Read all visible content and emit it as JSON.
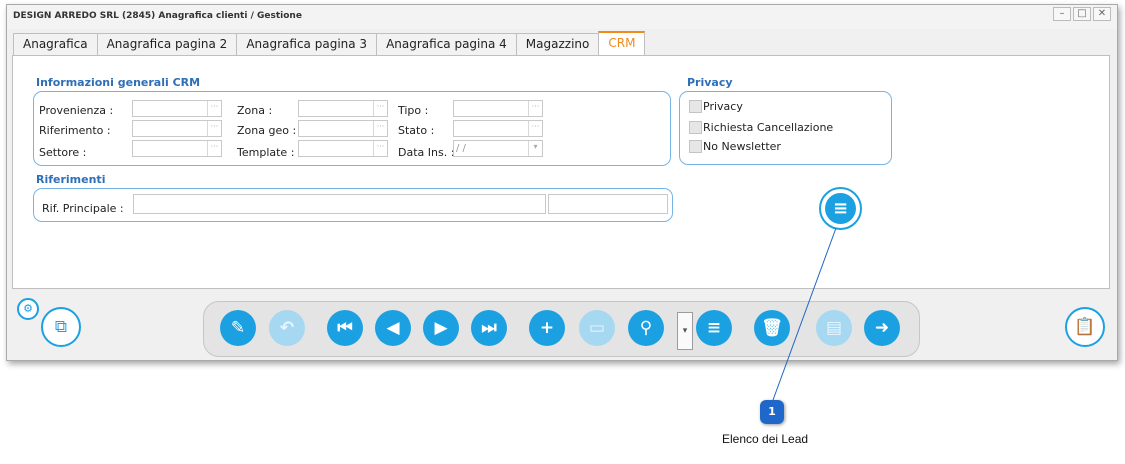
{
  "window": {
    "title": "DESIGN ARREDO SRL (2845) Anagrafica clienti / Gestione",
    "controls": {
      "minimize": "–",
      "maximize": "□",
      "close": "✕"
    }
  },
  "tabs": [
    "Anagrafica",
    "Anagrafica pagina 2",
    "Anagrafica pagina 3",
    "Anagrafica pagina 4",
    "Magazzino",
    "CRM"
  ],
  "active_tab": "CRM",
  "crm": {
    "title": "Informazioni generali CRM",
    "provenienza": "Provenienza :",
    "riferimento": "Riferimento :",
    "settore": "Settore :",
    "zona": "Zona :",
    "zona_geo": "Zona geo :",
    "template": "Template :",
    "tipo": "Tipo :",
    "stato": "Stato :",
    "data_ins": "Data Ins. :",
    "data_ins_value": "/ /"
  },
  "privacy": {
    "title": "Privacy",
    "privacy": "Privacy",
    "richiesta": "Richiesta Cancellazione",
    "newsletter": "No Newsletter"
  },
  "riferimenti": {
    "title": "Riferimenti",
    "rif_principale": "Rif. Principale :"
  },
  "callout": {
    "number": "1",
    "label": "Elenco dei Lead"
  },
  "colors": {
    "accent": "#1ba1e2",
    "tab_active": "#f08a1c",
    "group_title": "#2e6fb7",
    "callout": "#1f67c8"
  },
  "icons": {
    "edit": "✎",
    "undo": "↶",
    "first": "⏮",
    "prev": "◀",
    "next": "▶",
    "last": "⏭",
    "new": "+",
    "save": "▭",
    "search": "⚲",
    "dropdown": "▾",
    "list": "≡",
    "delete": "🗑",
    "folder": "▤",
    "exit": "➜",
    "copy": "⧉",
    "gear": "⚙",
    "clipboard": "📋"
  }
}
